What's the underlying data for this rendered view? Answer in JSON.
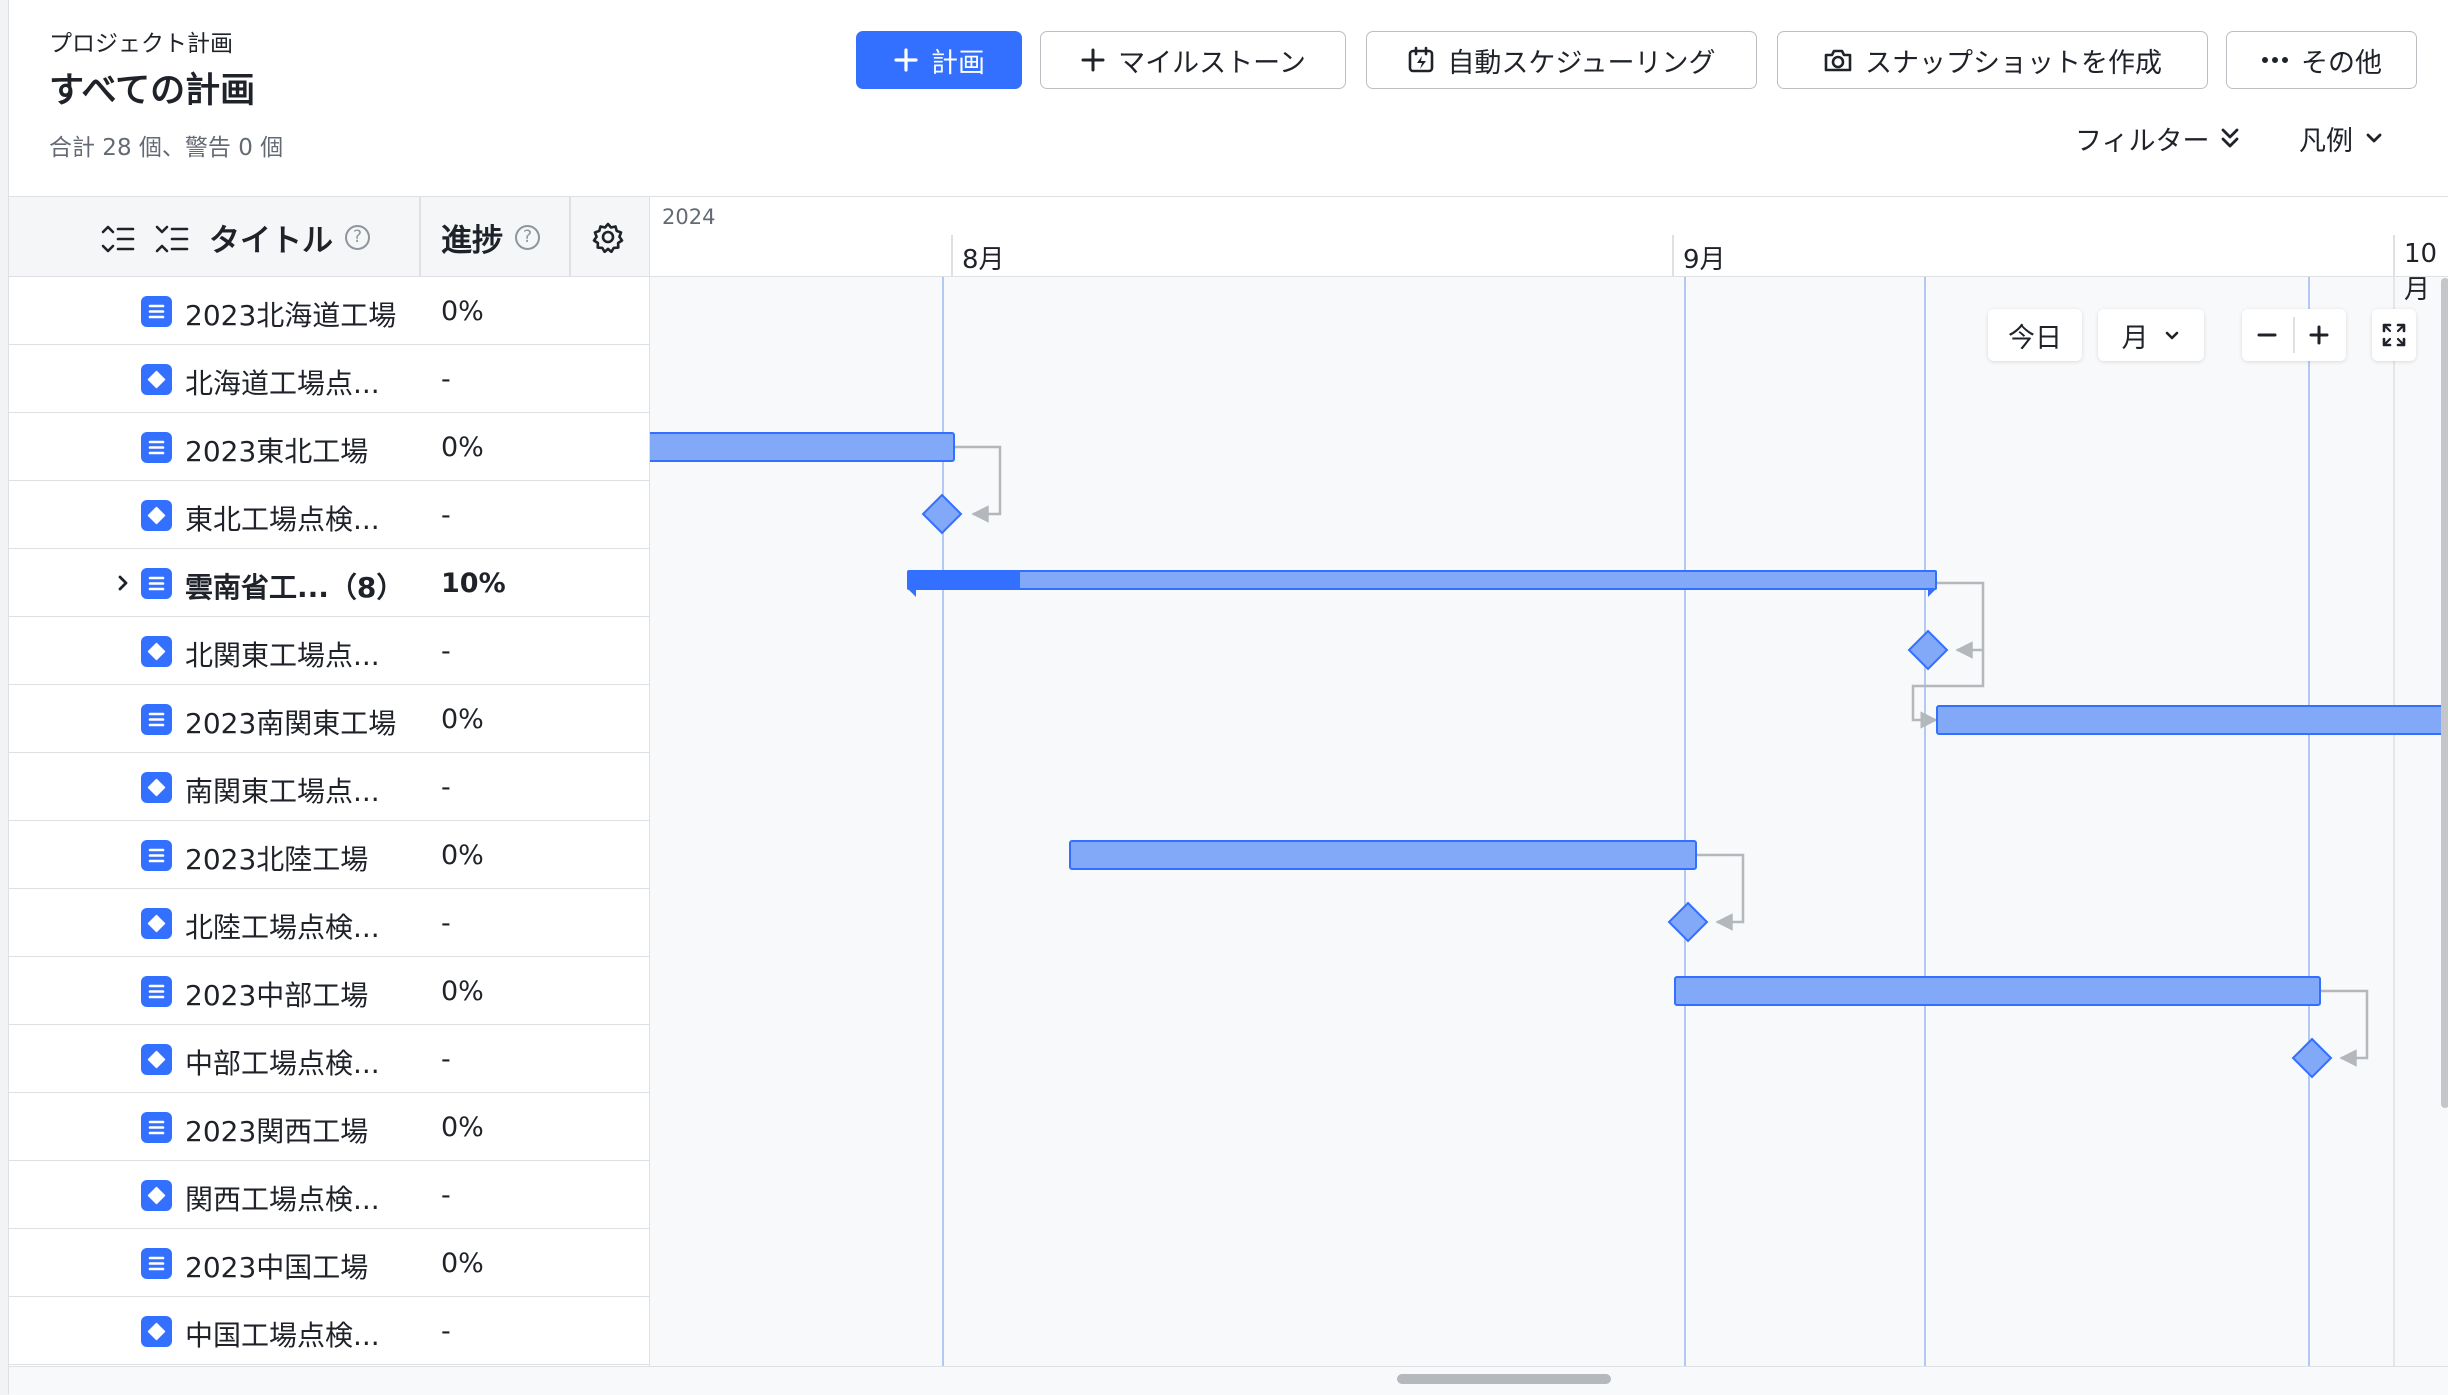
{
  "header": {
    "breadcrumb": "プロジェクト計画",
    "title": "すべての計画",
    "summary": "合計 28 個、警告 0 個",
    "buttons": {
      "add_plan": "計画",
      "milestone": "マイルストーン",
      "auto_schedule": "自動スケジューリング",
      "snapshot": "スナップショットを作成",
      "more": "その他"
    },
    "filter_label": "フィルター",
    "legend_label": "凡例"
  },
  "table": {
    "columns": {
      "title": "タイトル",
      "progress": "進捗"
    },
    "rows": [
      {
        "kind": "plan",
        "title": "2023北海道工場",
        "progress": "0%"
      },
      {
        "kind": "milestone",
        "title": "北海道工場点...",
        "progress": "-"
      },
      {
        "kind": "plan",
        "title": "2023東北工場",
        "progress": "0%"
      },
      {
        "kind": "milestone",
        "title": "東北工場点検...",
        "progress": "-"
      },
      {
        "kind": "plan",
        "title": "雲南省工...（8）",
        "progress": "10%",
        "bold": true,
        "expandable": true
      },
      {
        "kind": "milestone",
        "title": "北関東工場点...",
        "progress": "-"
      },
      {
        "kind": "plan",
        "title": "2023南関東工場",
        "progress": "0%"
      },
      {
        "kind": "milestone",
        "title": "南関東工場点...",
        "progress": "-"
      },
      {
        "kind": "plan",
        "title": "2023北陸工場",
        "progress": "0%"
      },
      {
        "kind": "milestone",
        "title": "北陸工場点検...",
        "progress": "-"
      },
      {
        "kind": "plan",
        "title": "2023中部工場",
        "progress": "0%"
      },
      {
        "kind": "milestone",
        "title": "中部工場点検...",
        "progress": "-"
      },
      {
        "kind": "plan",
        "title": "2023関西工場",
        "progress": "0%"
      },
      {
        "kind": "milestone",
        "title": "関西工場点検...",
        "progress": "-"
      },
      {
        "kind": "plan",
        "title": "2023中国工場",
        "progress": "0%"
      },
      {
        "kind": "milestone",
        "title": "中国工場点検...",
        "progress": "-"
      }
    ]
  },
  "timeline": {
    "year": "2024",
    "months": [
      "8月",
      "9月",
      "10月"
    ],
    "controls": {
      "today": "今日",
      "scale": "月"
    }
  },
  "colors": {
    "accent": "#3370ff",
    "bar_fill": "#82a9f7",
    "bar_border": "#3370ff",
    "dependency": "#b4b7bc"
  }
}
